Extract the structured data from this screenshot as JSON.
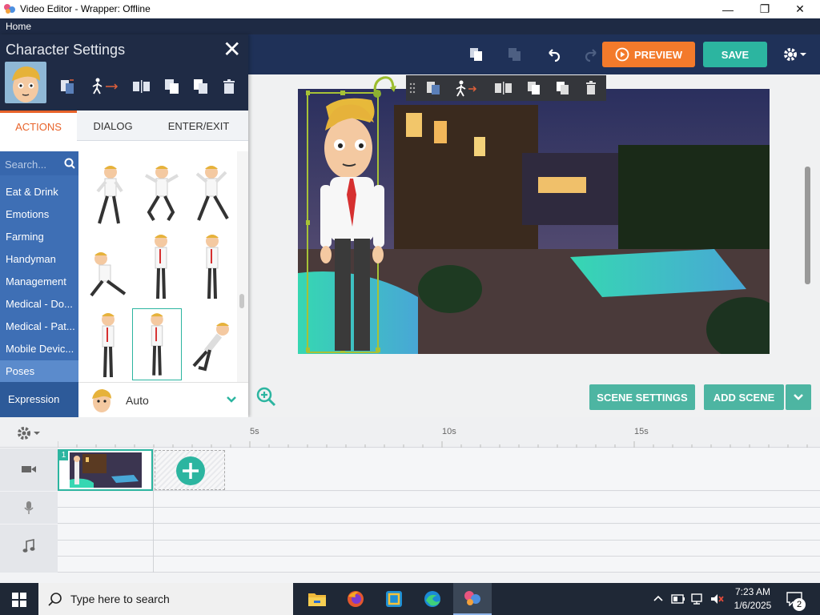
{
  "window": {
    "title": "Video Editor - Wrapper: Offline",
    "minimize": "—",
    "maximize": "❐",
    "close": "✕"
  },
  "menu": {
    "home": "Home"
  },
  "toolbar": {
    "preview_label": "PREVIEW",
    "save_label": "SAVE"
  },
  "panel": {
    "title": "Character Settings",
    "close_label": "✕",
    "tabs": [
      {
        "label": "ACTIONS",
        "active": true
      },
      {
        "label": "DIALOG"
      },
      {
        "label": "ENTER/EXIT"
      }
    ],
    "search_placeholder": "Search...",
    "categories": [
      {
        "label": "Eat & Drink"
      },
      {
        "label": "Emotions"
      },
      {
        "label": "Farming"
      },
      {
        "label": "Handyman"
      },
      {
        "label": "Management"
      },
      {
        "label": "Medical - Do..."
      },
      {
        "label": "Medical - Pat..."
      },
      {
        "label": "Mobile Devic..."
      },
      {
        "label": "Poses",
        "selected": true
      }
    ],
    "expression_label": "Expression",
    "expression_value": "Auto"
  },
  "stage": {
    "scene_settings_label": "SCENE SETTINGS",
    "add_scene_label": "ADD SCENE"
  },
  "timeline": {
    "ticks": [
      "5s",
      "10s",
      "15s"
    ],
    "scene_number": "1"
  },
  "taskbar": {
    "search_placeholder": "Type here to search",
    "time": "7:23 AM",
    "date": "1/6/2025",
    "notifications": "2"
  },
  "colors": {
    "accent_orange": "#f37a2b",
    "accent_teal": "#2cb5a0",
    "navy": "#1f3158",
    "category_blue": "#3e6fb5"
  }
}
